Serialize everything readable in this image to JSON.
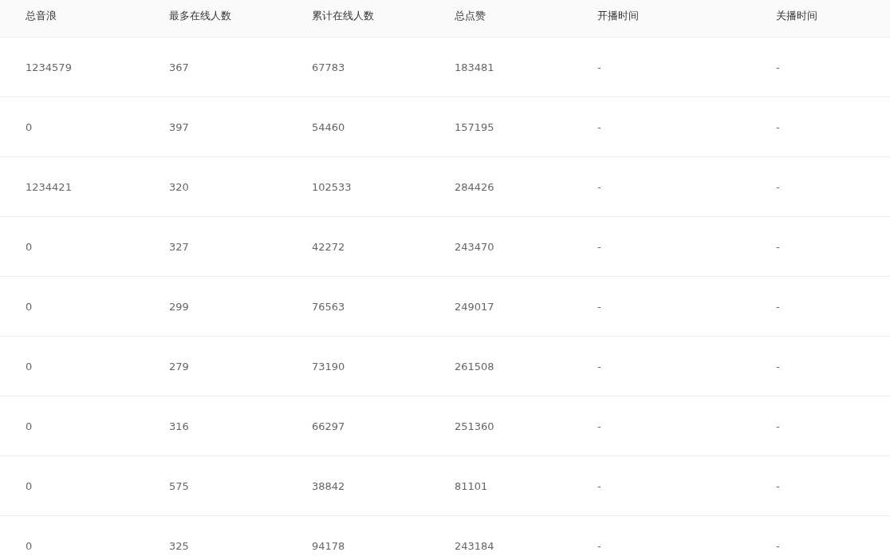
{
  "table": {
    "columns": [
      "总音浪",
      "最多在线人数",
      "累计在线人数",
      "总点赞",
      "开播时间",
      "关播时间"
    ],
    "rows": [
      [
        "1234579",
        "367",
        "67783",
        "183481",
        "-",
        "-"
      ],
      [
        "0",
        "397",
        "54460",
        "157195",
        "-",
        "-"
      ],
      [
        "1234421",
        "320",
        "102533",
        "284426",
        "-",
        "-"
      ],
      [
        "0",
        "327",
        "42272",
        "243470",
        "-",
        "-"
      ],
      [
        "0",
        "299",
        "76563",
        "249017",
        "-",
        "-"
      ],
      [
        "0",
        "279",
        "73190",
        "261508",
        "-",
        "-"
      ],
      [
        "0",
        "316",
        "66297",
        "251360",
        "-",
        "-"
      ],
      [
        "0",
        "575",
        "38842",
        "81101",
        "-",
        "-"
      ],
      [
        "0",
        "325",
        "94178",
        "243184",
        "-",
        "-"
      ]
    ]
  }
}
